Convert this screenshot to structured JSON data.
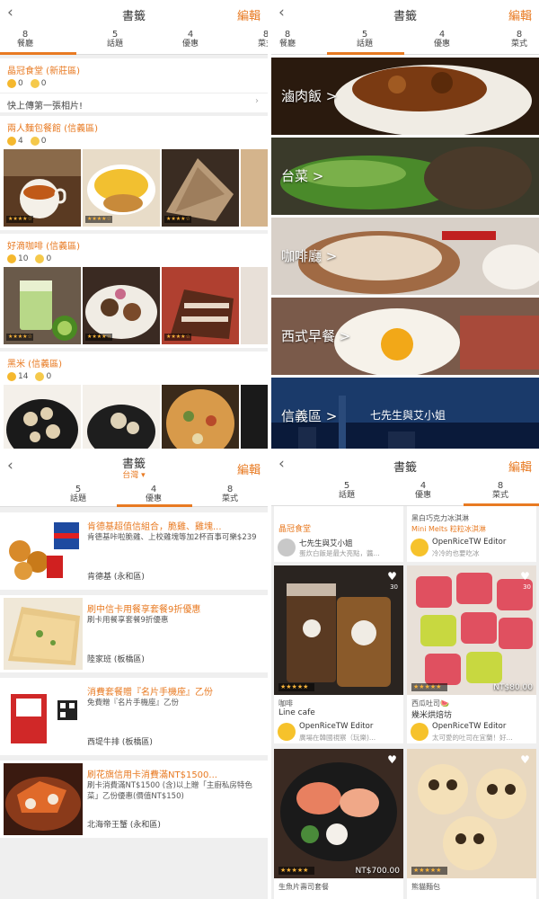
{
  "screen_title": "書籤",
  "edit_label": "編輯",
  "back_icon": "chevron-left-icon",
  "tabs": [
    {
      "count": "8",
      "label": "餐廳"
    },
    {
      "count": "5",
      "label": "話題"
    },
    {
      "count": "4",
      "label": "優惠"
    },
    {
      "count": "8",
      "label": "菜式"
    }
  ],
  "accent_color": "#e87a22",
  "restaurants": {
    "items": [
      {
        "name": "晶冠食堂 (新莊區)",
        "smile": "0",
        "sad": "0",
        "upload": "快上傳第一張相片!"
      },
      {
        "name": "兩人麵包餐館 (信義區)",
        "smile": "4",
        "sad": "0"
      },
      {
        "name": "好滴咖啡 (信義區)",
        "smile": "10",
        "sad": "0"
      },
      {
        "name": "黑米 (信義區)",
        "smile": "14",
        "sad": "0"
      }
    ],
    "star_text": "★★★★☆"
  },
  "topics": {
    "items": [
      {
        "label": "滷肉飯 >"
      },
      {
        "label": "台菜 >"
      },
      {
        "label": "咖啡廳 >"
      },
      {
        "label": "西式早餐 >"
      },
      {
        "label": "信義區 >",
        "watermark": "七先生與艾小姐"
      }
    ]
  },
  "deals": {
    "region": "台灣",
    "items": [
      {
        "title": "肯德基超值信組合，脆雞、雞塊...",
        "desc": "肯德基咔啦脆雞、上校雞塊等加2杯百事可樂$239",
        "shop": "肯德基 (永和區)"
      },
      {
        "title": "刷中信卡用餐享套餐9折優惠",
        "desc": "刷卡用餐享套餐9折優惠",
        "shop": "陸家班 (板橋區)"
      },
      {
        "title": "消費套餐贈『名片手機座』乙份",
        "desc": "免費贈『名片手機座』乙份",
        "shop": "西堤牛排 (板橋區)"
      },
      {
        "title": "刷花旗信用卡消費滿NT$1500...",
        "desc": "刷卡消費滿NT$1500 (含)以上贈「主廚私房特色菜」乙份優惠(價值NT$150)",
        "shop": "北海帝王蟹 (永和區)"
      }
    ]
  },
  "dishes": {
    "top_left": {
      "name": "晶冠食堂",
      "user": "七先生與艾小姐",
      "comment": "蛋炊白飯是最大亮點，醬..."
    },
    "top_right": {
      "dish": "黑白巧克力冰淇淋",
      "name": "Mini Melts 粒粒冰淇淋",
      "user": "OpenRiceTW Editor",
      "comment": "冷冷的也要吃冰"
    },
    "mid_left": {
      "dish": "咖啡",
      "name": "Line cafe",
      "user": "OpenRiceTW Editor",
      "comment": "廣場在韓國視察（玩樂)...",
      "likes": "30"
    },
    "mid_right": {
      "dish": "西瓜吐司🍉",
      "name": "幾米烘焙坊",
      "price": "NT$80.00",
      "user": "OpenRiceTW Editor",
      "comment": "太可愛的吐司在宜蘭！好...",
      "likes": "30"
    },
    "bot_left": {
      "dish": "生魚片壽司套餐",
      "price": "NT$700.00"
    },
    "bot_right": {
      "dish": "熊貓麵包"
    },
    "star_text": "★★★★★"
  }
}
